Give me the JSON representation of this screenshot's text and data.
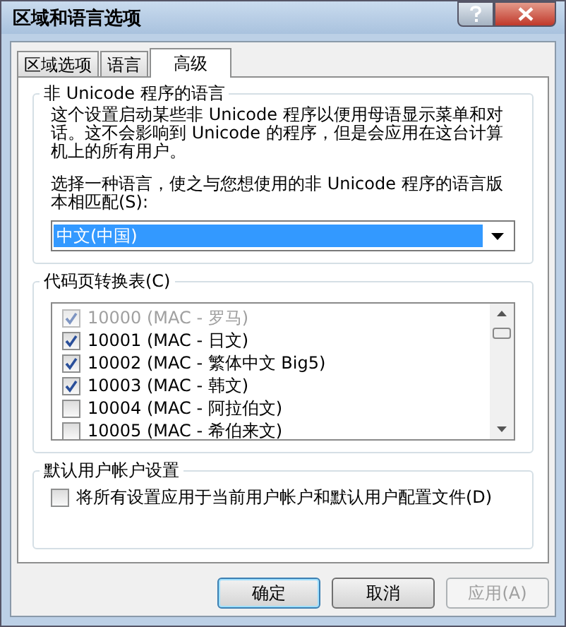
{
  "window": {
    "title": "区域和语言选项"
  },
  "tabs": [
    {
      "label": "区域选项",
      "selected": false
    },
    {
      "label": "语言",
      "selected": false
    },
    {
      "label": "高级",
      "selected": true
    }
  ],
  "non_unicode_group": {
    "title": "非 Unicode 程序的语言",
    "description": "这个设置启动某些非 Unicode 程序以便用母语显示菜单和对话。这不会影响到 Unicode 的程序，但是会应用在这台计算机上的所有用户。",
    "prompt": "选择一种语言，使之与您想使用的非 Unicode 程序的语言版本相匹配(S):",
    "dropdown": {
      "value": "中文(中国)"
    }
  },
  "code_page_group": {
    "title": "代码页转换表(C)",
    "items": [
      {
        "label": "10000 (MAC - 罗马)",
        "checked": true,
        "disabled": true
      },
      {
        "label": "10001 (MAC - 日文)",
        "checked": true,
        "disabled": false
      },
      {
        "label": "10002 (MAC - 繁体中文 Big5)",
        "checked": true,
        "disabled": false
      },
      {
        "label": "10003 (MAC - 韩文)",
        "checked": true,
        "disabled": false
      },
      {
        "label": "10004 (MAC - 阿拉伯文)",
        "checked": false,
        "disabled": false
      },
      {
        "label": "10005 (MAC - 希伯来文)",
        "checked": false,
        "disabled": false
      }
    ]
  },
  "default_user_group": {
    "title": "默认用户帐户设置",
    "checkbox": {
      "label": "将所有设置应用于当前用户帐户和默认用户配置文件(D)",
      "checked": false
    }
  },
  "buttons": [
    {
      "label": "确定",
      "kind": "default",
      "disabled": false
    },
    {
      "label": "取消",
      "kind": "normal",
      "disabled": false
    },
    {
      "label": "应用(A)",
      "kind": "normal",
      "disabled": true
    }
  ]
}
